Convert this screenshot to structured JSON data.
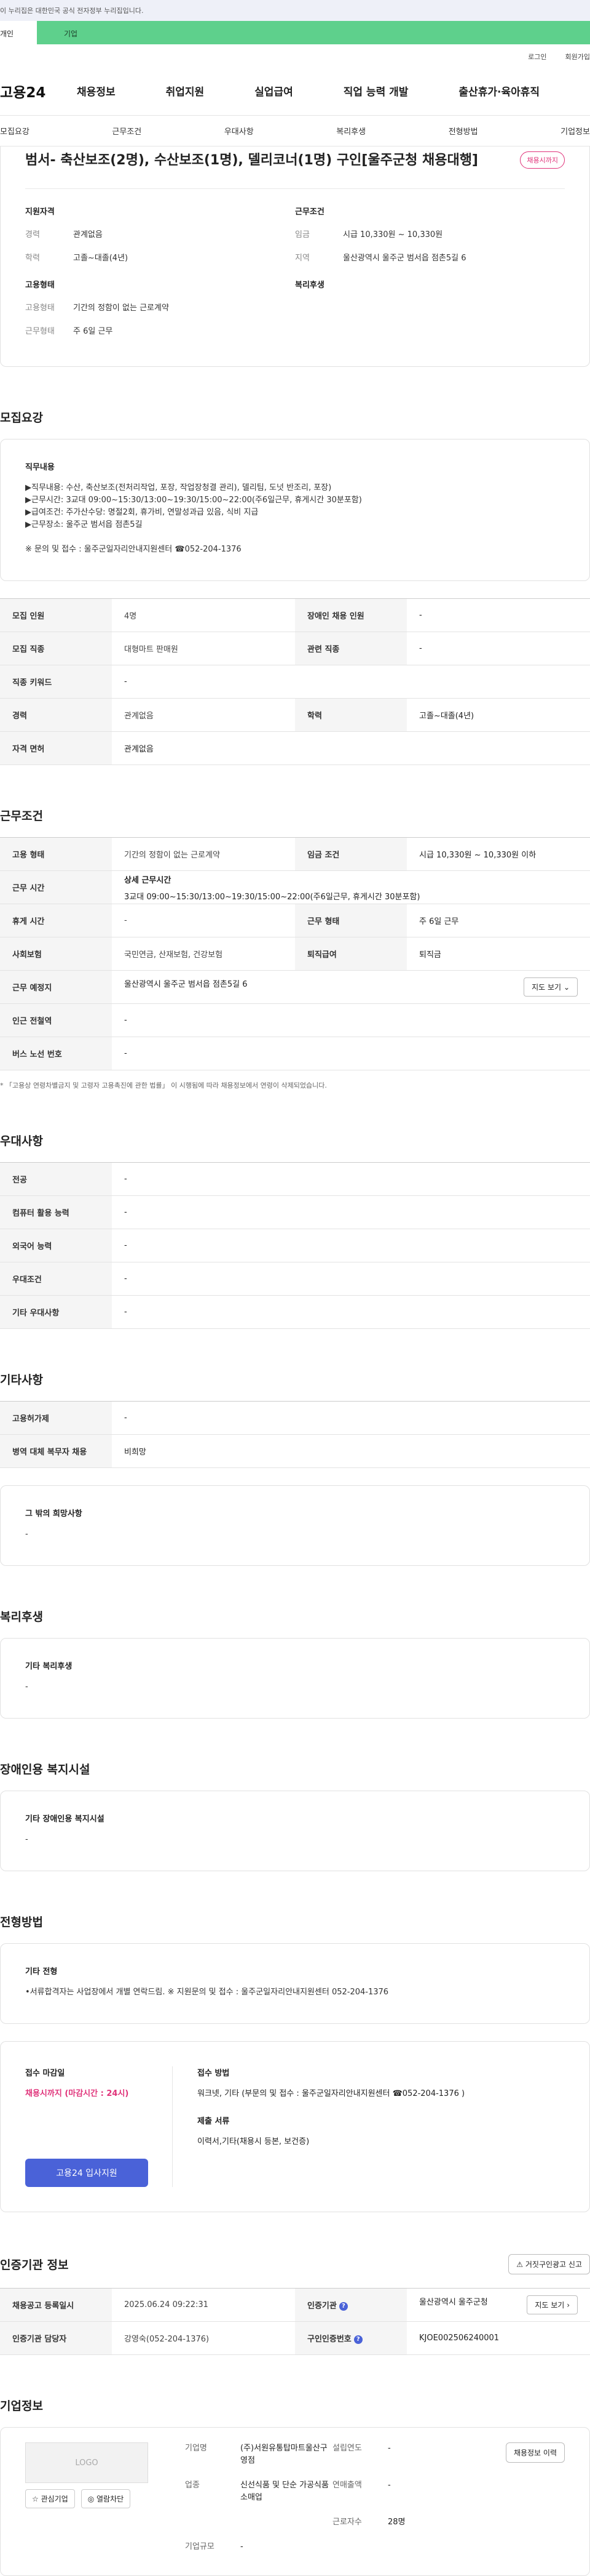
{
  "gov_banner": "이 누리집은 대한민국 공식 전자정부 누리집입니다.",
  "top_tabs": [
    "개인",
    "기업"
  ],
  "util": [
    "로그인",
    "회원가입"
  ],
  "gnb": {
    "logo": "고용24",
    "menu": [
      "채용정보",
      "취업지원",
      "실업급여",
      "직업 능력 개발",
      "출산휴가·육아휴직"
    ]
  },
  "anchors": [
    "모집요강",
    "근무조건",
    "우대사항",
    "복리후생",
    "전형방법",
    "기업정보"
  ],
  "summary": {
    "title": "범서- 축산보조(2명), 수산보조(1명), 델리코너(1명) 구인[울주군청 채용대행]",
    "badge": "채용시까지",
    "qual_title": "지원자격",
    "qual": [
      {
        "k": "경력",
        "v": "관계없음"
      },
      {
        "k": "학력",
        "v": "고졸~대졸(4년)"
      }
    ],
    "cond_title": "근무조건",
    "cond": [
      {
        "k": "임금",
        "v": "시급 10,330원 ~ 10,330원"
      },
      {
        "k": "지역",
        "v": "울산광역시 울주군 범서읍 점촌5길 6"
      }
    ],
    "emp_title": "고용형태",
    "emp": [
      {
        "k": "고용형태",
        "v": "기간의 정함이 없는 근로계약"
      },
      {
        "k": "근무형태",
        "v": "주 6일 근무"
      }
    ],
    "welfare_title": "복리후생"
  },
  "recruit": {
    "title": "모집요강",
    "box_title": "직무내용",
    "lines": "▶직무내용: 수산, 축산보조(전처리작업, 포장, 작업장청결 관리), 델리팀, 도넛 반조리, 포장)\n▶근무시간: 3교대 09:00~15:30/13:00~19:30/15:00~22:00(주6일근무, 휴게시간 30분포함)\n▶급여조건: 주가산수당: 명절2회, 휴가비, 연말성과급 있음, 식비 지급\n▶근무장소: 울주군 범서읍 점촌5길\n\n※ 문의 및 접수 : 울주군일자리안내지원센터 ☎052-204-1376",
    "rows": [
      [
        "모집 인원",
        "4명",
        "장애인 채용 인원",
        "-"
      ],
      [
        "모집 직종",
        "대형마트 판매원",
        "관련 직종",
        "-"
      ],
      [
        "직종 키워드",
        "-"
      ],
      [
        "경력",
        "관계없음",
        "학력",
        "고졸~대졸(4년)"
      ],
      [
        "자격 면허",
        "관계없음"
      ]
    ]
  },
  "work": {
    "title": "근무조건",
    "emp_type_k": "고용 형태",
    "emp_type_v": "기간의 정함이 없는 근로계약",
    "wage_k": "임금 조건",
    "wage_v": "시급 10,330원 ~ 10,330원 이하",
    "hours_k": "근무 시간",
    "hours_sub": "상세 근무시간",
    "hours_v": "3교대 09:00~15:30/13:00~19:30/15:00~22:00(주6일근무, 휴게시간 30분포함)",
    "rest_k": "휴게 시간",
    "rest_v": "-",
    "form_k": "근무 형태",
    "form_v": "주 6일 근무",
    "ins_k": "사회보험",
    "ins_v": "국민연금, 산재보험, 건강보험",
    "sev_k": "퇴직급여",
    "sev_v": "퇴직금",
    "loc_k": "근무 예정지",
    "loc_v": "울산광역시 울주군 범서읍 점촌5길 6",
    "map_btn": "지도 보기",
    "subway_k": "인근 전철역",
    "subway_v": "-",
    "bus_k": "버스 노선 번호",
    "bus_v": "-",
    "note": "* 「고용상 연령차별금지 및 고령자 고용촉진에 관한 법률」 이 시행됨에 따라 채용정보에서 연령이 삭제되었습니다."
  },
  "pref": {
    "title": "우대사항",
    "rows": [
      [
        "전공",
        "-"
      ],
      [
        "컴퓨터 활용 능력",
        "-"
      ],
      [
        "외국어 능력",
        "-"
      ],
      [
        "우대조건",
        "-"
      ],
      [
        "기타 우대사항",
        "-"
      ]
    ]
  },
  "etc": {
    "title": "기타사항",
    "rows": [
      [
        "고용허가제",
        "-"
      ],
      [
        "병역 대체 복무자 채용",
        "비희망"
      ]
    ],
    "box_title": "그 밖의 희망사항",
    "box_v": "-"
  },
  "welfare": {
    "title": "복리후생",
    "box_title": "기타 복리후생",
    "box_v": "-"
  },
  "disabled": {
    "title": "장애인용 복지시설",
    "box_title": "기타 장애인용 복지시설",
    "box_v": "-"
  },
  "process": {
    "title": "전형방법",
    "box_title": "기타 전형",
    "box_v": "•서류합격자는 사업장에서 개별 연락드림. ※ 지원문의 및 접수 : 울주군일자리안내지원센터 052-204-1376",
    "deadline_k": "접수 마감일",
    "deadline_v": "채용시까지 (마감시간 : 24시)",
    "apply_btn": "고용24 입사지원",
    "method_k": "접수 방법",
    "method_v": "워크넷,\n기타 (부문의 및 접수 : 울주군일자리안내지원센터 ☎052-204-1376 )",
    "docs_k": "제출 서류",
    "docs_v": "이력서,기타(채용시 등본, 보건증)"
  },
  "agency": {
    "title": "인증기관 정보",
    "report_btn": "거짓구인광고 신고",
    "reg_k": "채용공고 등록일시",
    "reg_v": "2025.06.24 09:22:31",
    "org_k": "인증기관",
    "org_v": "울산광역시 울주군청",
    "map_btn": "지도 보기",
    "mgr_k": "인증기관 담당자",
    "mgr_v": "강영숙(052-204-1376)",
    "id_k": "구인인증번호",
    "id_v": "KJOE002506240001"
  },
  "company": {
    "title": "기업정보",
    "logo": "LOGO",
    "fav": "☆ 관심기업",
    "block": "◎ 열람차단",
    "history_btn": "채용정보 이력",
    "fields": [
      [
        "기업명",
        "(주)서원유통탑마트울산구영점"
      ],
      [
        "설립연도",
        "-"
      ],
      [
        "업종",
        "신선식품 및 단순 가공식품 소매업"
      ],
      [
        "연매출액",
        "-"
      ],
      [
        "",
        ""
      ],
      [
        "근로자수",
        "28명"
      ],
      [
        "기업규모",
        "-"
      ]
    ]
  }
}
